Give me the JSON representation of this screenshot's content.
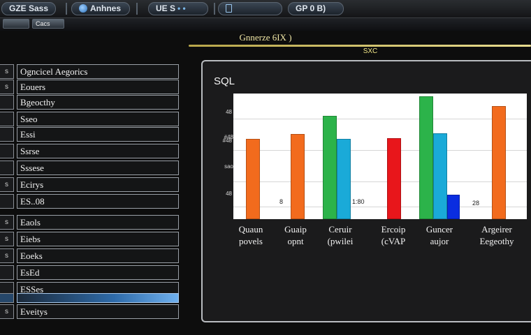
{
  "tabs": [
    {
      "label": "GZE Sass",
      "icon": "window-icon"
    },
    {
      "label": "Anhnes",
      "icon": "globe-icon"
    },
    {
      "label": "UE S",
      "icon": "tool-icon"
    },
    {
      "label": "",
      "icon": "document-icon"
    },
    {
      "label": "GP 0 B)",
      "icon": "link-icon"
    }
  ],
  "toolbar": {
    "btn1": "",
    "btn2": "Cacs"
  },
  "header": {
    "title": "Gnnerze 6IX )",
    "subtitle": "SXC"
  },
  "sidebar": {
    "items": [
      {
        "num": "s",
        "label": "Ogncicel Aegorics"
      },
      {
        "num": "s",
        "label": "Eouers"
      },
      {
        "num": "",
        "label": "Bgeocthy"
      },
      {
        "num": "",
        "label": "Sseo"
      },
      {
        "num": "",
        "label": "Essi"
      },
      {
        "num": "",
        "label": "Ssrse"
      },
      {
        "num": "",
        "label": "Sssese"
      },
      {
        "num": "s",
        "label": "Ecirys"
      },
      {
        "num": "",
        "label": "ES..08"
      },
      {
        "num": "s",
        "label": "Eaols"
      },
      {
        "num": "s",
        "label": "Eiebs"
      },
      {
        "num": "s",
        "label": "Eoeks"
      },
      {
        "num": "",
        "label": "EsEd"
      },
      {
        "num": "",
        "label": "ESSes"
      },
      {
        "num": "",
        "label": ""
      },
      {
        "num": "s",
        "label": "Eveitys"
      }
    ],
    "selected_index": 14
  },
  "chart_data": {
    "type": "bar",
    "title": "SQL",
    "ylim": [
      0,
      100
    ],
    "y_ticks": [
      {
        "label": "48",
        "value": 85
      },
      {
        "label": "#48",
        "value": 62
      },
      {
        "label": "48",
        "value": 20
      }
    ],
    "y_tick_extra": [
      "#48",
      "sao"
    ],
    "groups": [
      {
        "label_lines": [
          "Quaun",
          "povels"
        ],
        "bars": [
          {
            "color": "#f26b1d",
            "value": 65
          }
        ]
      },
      {
        "label_lines": [
          "Guaip",
          "opnt"
        ],
        "bars": [
          {
            "color": "#f26b1d",
            "value": 69
          }
        ]
      },
      {
        "label_lines": [
          "Ceruir",
          "(pwilei"
        ],
        "bars": [
          {
            "color": "#2cb34a",
            "value": 84
          },
          {
            "color": "#1aaad8",
            "value": 65
          }
        ]
      },
      {
        "label_lines": [
          "Ercoip",
          "(cVAP"
        ],
        "bars": [
          {
            "color": "#e8161b",
            "value": 66
          }
        ]
      },
      {
        "label_lines": [
          "Guncer",
          "aujor"
        ],
        "bars": [
          {
            "color": "#2cb34a",
            "value": 100
          },
          {
            "color": "#1aaad8",
            "value": 70
          },
          {
            "color": "#0a2de0",
            "value": 20
          }
        ]
      },
      {
        "label_lines": [
          "Argeirer",
          "Eegeothy"
        ],
        "bars": [
          {
            "color": "#f26b1d",
            "value": 92
          }
        ]
      }
    ],
    "data_labels": [
      "8",
      "1:80",
      "28"
    ]
  }
}
